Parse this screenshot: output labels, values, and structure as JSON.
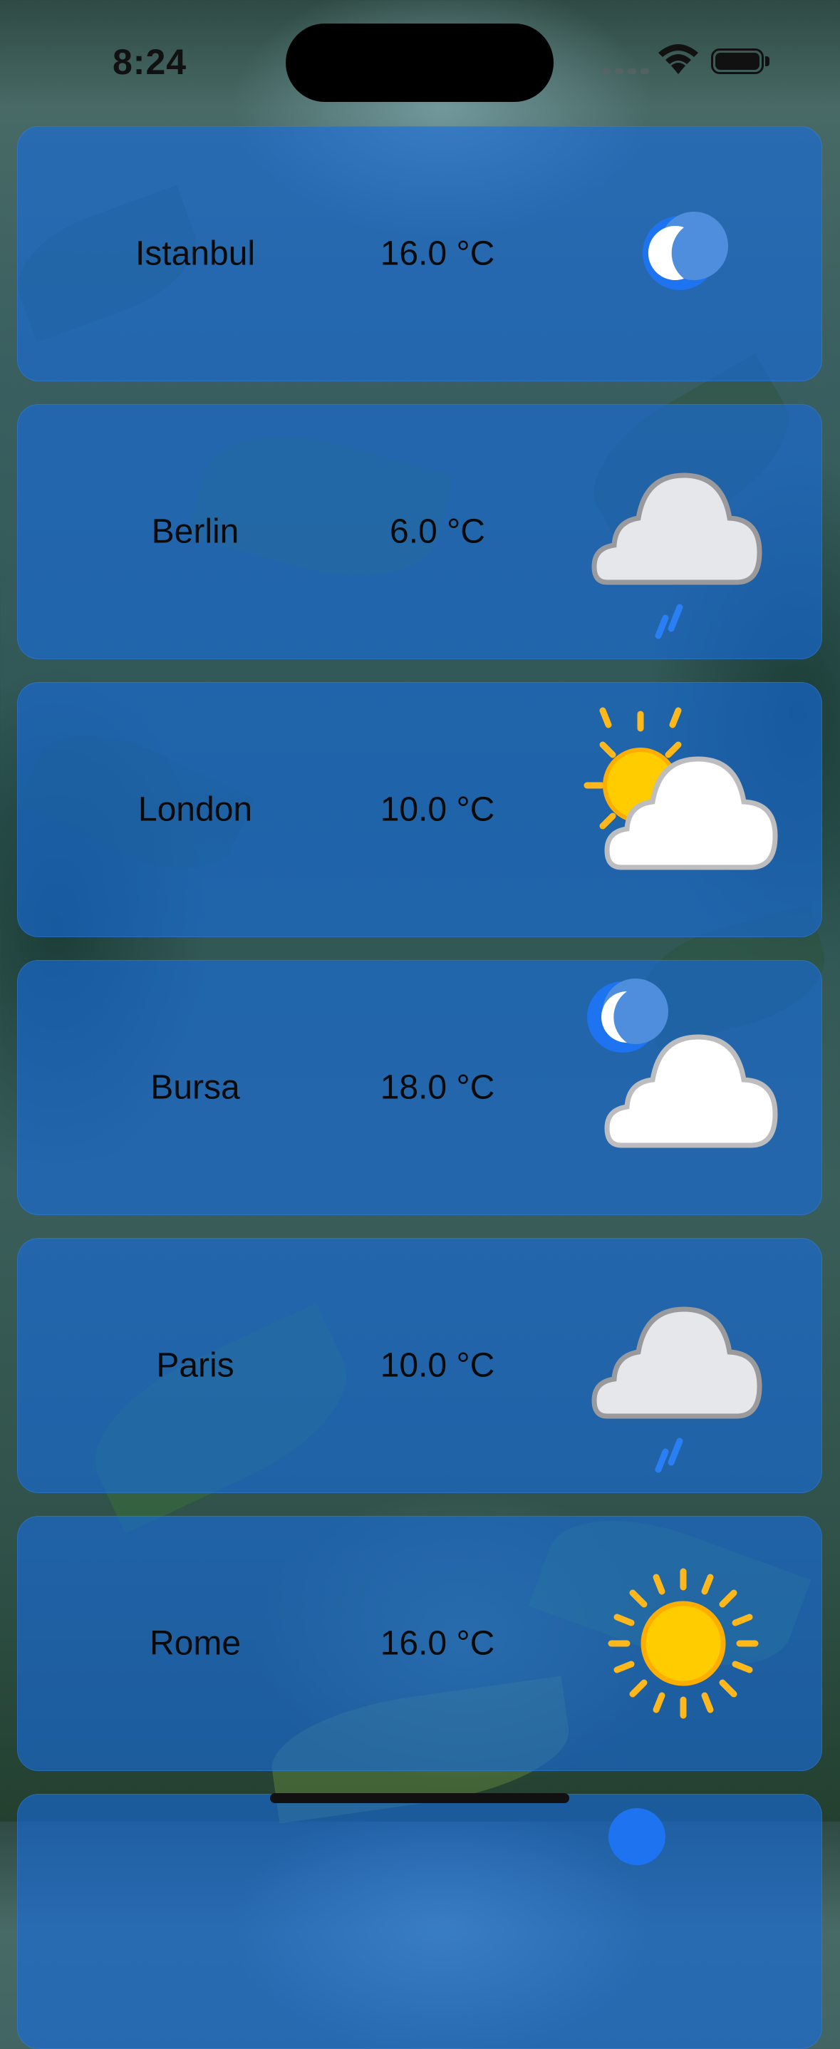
{
  "status_bar": {
    "time": "8:24"
  },
  "cities": [
    {
      "name": "Istanbul",
      "temperature": "16.0 °C",
      "icon": "moon-icon"
    },
    {
      "name": "Berlin",
      "temperature": "6.0 °C",
      "icon": "cloud-rain-icon"
    },
    {
      "name": "London",
      "temperature": "10.0 °C",
      "icon": "sun-behind-cloud-icon"
    },
    {
      "name": "Bursa",
      "temperature": "18.0 °C",
      "icon": "moon-cloud-icon"
    },
    {
      "name": "Paris",
      "temperature": "10.0 °C",
      "icon": "cloud-rain-icon"
    },
    {
      "name": "Rome",
      "temperature": "16.0 °C",
      "icon": "sun-icon"
    },
    {
      "name": "",
      "temperature": "",
      "icon": "moon-icon"
    }
  ],
  "colors": {
    "card": "#166cde",
    "moon": "#1e74f0",
    "sun": "#ffcc00",
    "cloud": "#e6e7ea"
  }
}
